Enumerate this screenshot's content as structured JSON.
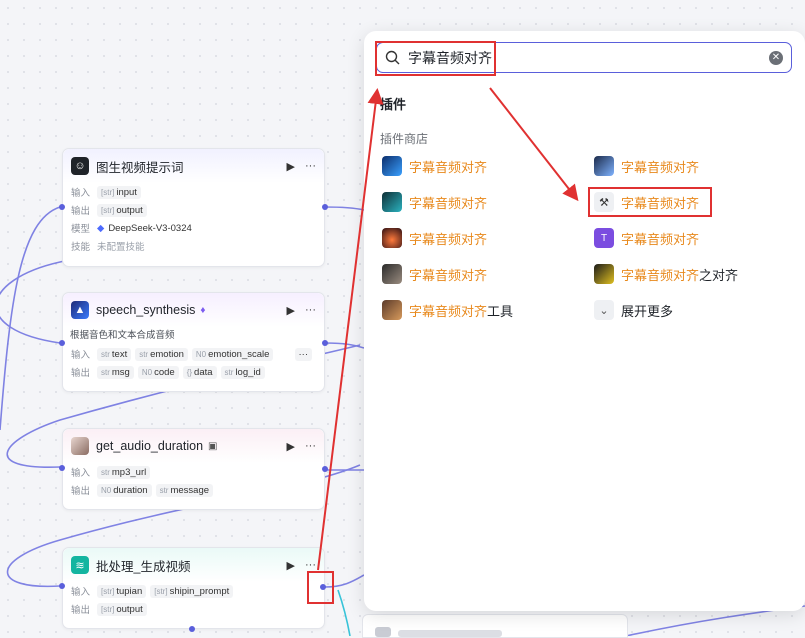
{
  "nodes": [
    {
      "title": "图生视频提示词",
      "rows": [
        {
          "label": "输入",
          "chips": [
            {
              "type": "[str]",
              "name": "input"
            }
          ]
        },
        {
          "label": "输出",
          "chips": [
            {
              "type": "[str]",
              "name": "output"
            }
          ]
        },
        {
          "label": "模型",
          "model": "DeepSeek-V3-0324"
        },
        {
          "label": "技能",
          "text": "未配置技能"
        }
      ]
    },
    {
      "title": "speech_synthesis",
      "description": "根据音色和文本合成音频",
      "rows": [
        {
          "label": "输入",
          "chips": [
            {
              "type": "str",
              "name": "text"
            },
            {
              "type": "str",
              "name": "emotion"
            },
            {
              "type": "N0",
              "name": "emotion_scale"
            }
          ]
        },
        {
          "label": "输出",
          "chips": [
            {
              "type": "str",
              "name": "msg"
            },
            {
              "type": "N0",
              "name": "code"
            },
            {
              "type": "{}",
              "name": "data"
            },
            {
              "type": "str",
              "name": "log_id"
            }
          ]
        }
      ]
    },
    {
      "title": "get_audio_duration",
      "rows": [
        {
          "label": "输入",
          "chips": [
            {
              "type": "str",
              "name": "mp3_url"
            }
          ]
        },
        {
          "label": "输出",
          "chips": [
            {
              "type": "N0",
              "name": "duration"
            },
            {
              "type": "str",
              "name": "message"
            }
          ]
        }
      ]
    },
    {
      "title": "批处理_生成视频",
      "rows": [
        {
          "label": "输入",
          "chips": [
            {
              "type": "[str]",
              "name": "tupian"
            },
            {
              "type": "[str]",
              "name": "shipin_prompt"
            }
          ]
        },
        {
          "label": "输出",
          "chips": [
            {
              "type": "[str]",
              "name": "output"
            }
          ]
        }
      ]
    }
  ],
  "node_actions": {
    "run": "▶",
    "more": "···"
  },
  "panel": {
    "search_value": "字幕音频对齐",
    "section_title": "插件",
    "subsection_title": "插件商店",
    "items": [
      {
        "hl": "字幕音频对齐",
        "rest": ""
      },
      {
        "hl": "字幕音频对齐",
        "rest": ""
      },
      {
        "hl": "字幕音频对齐",
        "rest": ""
      },
      {
        "hl": "字幕音频对齐",
        "rest": ""
      },
      {
        "hl": "字幕音频对齐",
        "rest": ""
      },
      {
        "hl": "字幕音频对齐",
        "rest": ""
      },
      {
        "hl": "字幕音频对齐",
        "rest": ""
      },
      {
        "hl": "字幕音频对齐",
        "rest": "之对齐"
      },
      {
        "hl": "字幕音频对齐",
        "rest": "工具"
      }
    ],
    "expand_more": "展开更多"
  },
  "colors": {
    "accent": "#5a5fdb",
    "highlight": "#e8891c",
    "annotation": "#e03131"
  }
}
